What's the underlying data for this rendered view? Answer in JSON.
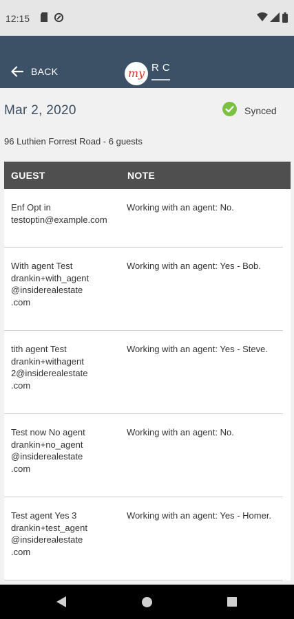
{
  "status_bar": {
    "time": "12:15",
    "left_icons": [
      "sd-card-icon",
      "data-saver-icon"
    ],
    "right_icons": [
      "wifi-icon",
      "signal-icon",
      "battery-icon"
    ]
  },
  "app_bar": {
    "back_label": "BACK",
    "logo": {
      "script_text": "my",
      "letters": "RC"
    },
    "background_color": "#3c5166"
  },
  "event": {
    "date": "Mar 2, 2020",
    "sync_status": "Synced",
    "sync_color": "#7ac043",
    "summary": "96 Luthien Forrest Road - 6 guests"
  },
  "table": {
    "headers": {
      "guest": "GUEST",
      "note": "NOTE"
    },
    "rows": [
      {
        "guest": "Enf Opt in\ntestoptin@example.com",
        "note": "Working with an agent: No."
      },
      {
        "guest": "With agent Test\ndrankin+with_agent\n@insiderealestate\n.com",
        "note": "Working with an agent: Yes -  Bob."
      },
      {
        "guest": "tith agent Test\ndrankin+withagent\n2@insiderealestate\n.com",
        "note": "Working with an agent: Yes -  Steve."
      },
      {
        "guest": "Test now No agent\ndrankin+no_agent\n@insiderealestate\n.com",
        "note": "Working with an agent: No."
      },
      {
        "guest": "Test agent  Yes 3\ndrankin+test_agent\n@insiderealestate\n.com",
        "note": "Working with an agent: Yes -  Homer."
      }
    ]
  },
  "nav_bar": {
    "buttons": [
      "back-triangle-icon",
      "home-circle-icon",
      "recents-square-icon"
    ]
  }
}
